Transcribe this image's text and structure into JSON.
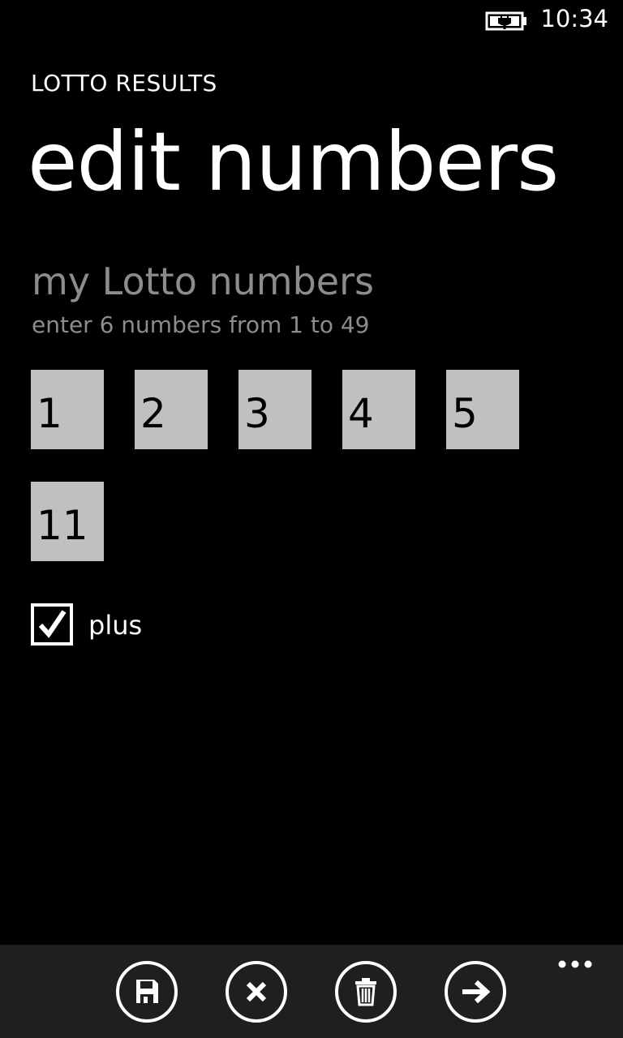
{
  "status_bar": {
    "time": "10:34",
    "battery_icon": "battery-charging-icon"
  },
  "header": {
    "app_title": "LOTTO RESULTS",
    "page_title": "edit numbers"
  },
  "section": {
    "title": "my Lotto numbers",
    "hint": "enter 6 numbers from 1 to 49"
  },
  "numbers": [
    "1",
    "2",
    "3",
    "4",
    "5",
    "11"
  ],
  "plus_option": {
    "label": "plus",
    "checked": true
  },
  "app_bar": {
    "buttons": [
      {
        "icon": "save-icon"
      },
      {
        "icon": "cancel-icon"
      },
      {
        "icon": "delete-icon"
      },
      {
        "icon": "next-arrow-icon"
      }
    ],
    "more": "more-icon"
  },
  "colors": {
    "background": "#000000",
    "input_background": "#c0c0c0",
    "secondary_text": "#8c8c8c",
    "app_bar": "#1f1f1f"
  }
}
